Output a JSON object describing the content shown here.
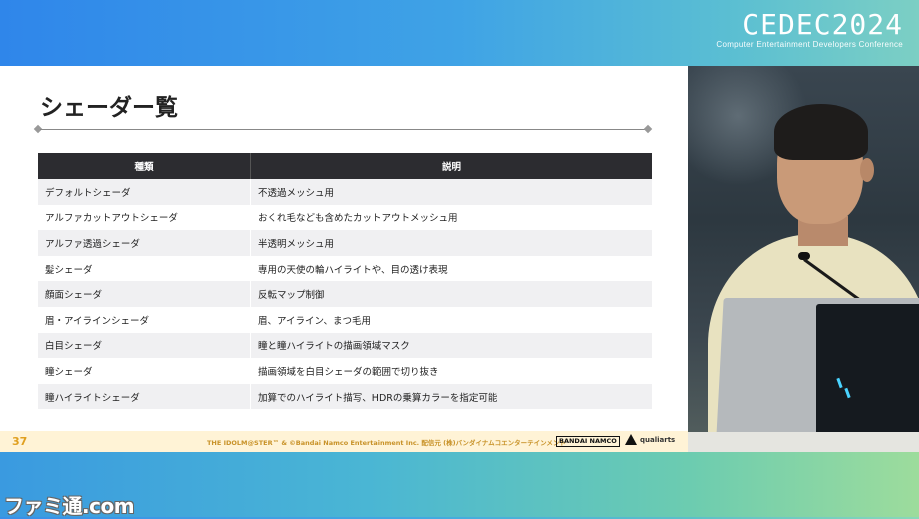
{
  "event": {
    "logo_main": "CEDEC2024",
    "logo_sub": "Computer Entertainment Developers Conference"
  },
  "slide": {
    "title": "シェーダー覧",
    "table": {
      "headers": [
        "種類",
        "説明"
      ],
      "rows": [
        [
          "デフォルトシェーダ",
          "不透過メッシュ用"
        ],
        [
          "アルファカットアウトシェーダ",
          "おくれ毛なども含めたカットアウトメッシュ用"
        ],
        [
          "アルファ透過シェーダ",
          "半透明メッシュ用"
        ],
        [
          "髪シェーダ",
          "専用の天使の輪ハイライトや、目の透け表現"
        ],
        [
          "顔面シェーダ",
          "反転マップ制御"
        ],
        [
          "眉・アイラインシェーダ",
          "眉、アイライン、まつ毛用"
        ],
        [
          "白目シェーダ",
          "瞳と瞳ハイライトの描画領域マスク"
        ],
        [
          "瞳シェーダ",
          "描画領域を白目シェーダの範囲で切り抜き"
        ],
        [
          "瞳ハイライトシェーダ",
          "加算でのハイライト描写、HDRの乗算カラーを指定可能"
        ]
      ]
    },
    "footer": {
      "page_number": "37",
      "copyright": "THE IDOLM@STER™ & ©Bandai Namco Entertainment Inc. 配信元 (株)バンダイナムコエンターテインメント",
      "logo_bandai": "BANDAI NAMCO",
      "logo_qualiarts": "qualiarts"
    }
  },
  "watermark": "ファミ通.com",
  "colors": {
    "header_bg": "#2c2c30",
    "row_alt": "#f0f0f2",
    "footer_bg": "#fff3d6",
    "accent_orange": "#e0a020"
  }
}
